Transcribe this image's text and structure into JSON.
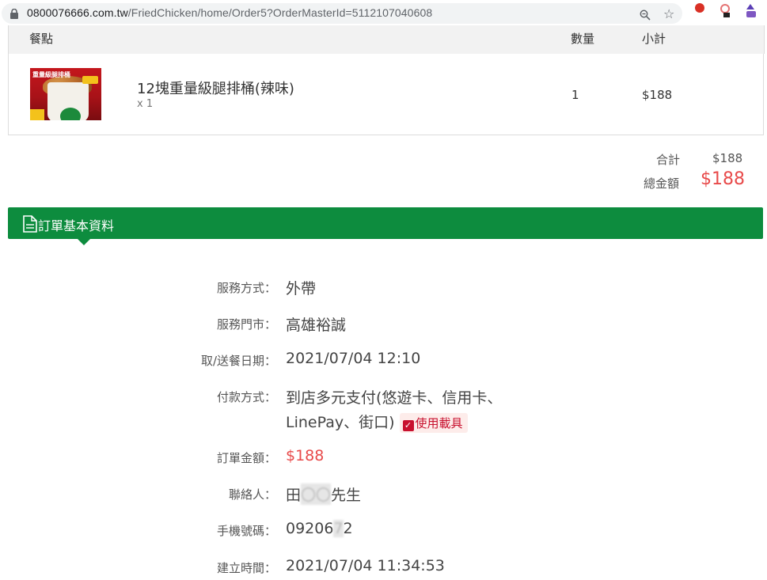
{
  "browser": {
    "url_host": "0800076666.com.tw",
    "url_path": "/FriedChicken/home/Order5?OrderMasterId=5112107040608"
  },
  "table": {
    "headers": {
      "item": "餐點",
      "qty": "數量",
      "subtotal": "小計"
    },
    "rows": [
      {
        "image_text": "重量級腿排桶",
        "name": "12塊重量級腿排桶(辣味)",
        "qty_note": "x 1",
        "qty": "1",
        "subtotal": "$188"
      }
    ]
  },
  "summary": {
    "subtotal_label": "合計",
    "subtotal_value": "$188",
    "total_label": "總金額",
    "total_value": "$188"
  },
  "section": {
    "title": "訂單基本資料"
  },
  "order_info": {
    "service_label": "服務方式：",
    "service_value": "外帶",
    "store_label": "服務門市：",
    "store_value": "高雄裕誠",
    "date_label": "取/送餐日期：",
    "date_value": "2021/07/04 12:10",
    "payment_label": "付款方式：",
    "payment_line1": "到店多元支付(悠遊卡、信用卡、",
    "payment_line2": "LinePay、街口)",
    "payment_badge": "使用載具",
    "amount_label": "訂單金額：",
    "amount_value": "$188",
    "contact_label": "聯絡人：",
    "contact_value_start": "田",
    "contact_value_hidden": "〇〇",
    "contact_value_end": "先生",
    "phone_label": "手機號碼：",
    "phone_value_start": "09206",
    "phone_value_hidden": "7",
    "phone_value_end": "2",
    "created_label": "建立時間：",
    "created_value": "2021/07/04 11:34:53"
  },
  "colors": {
    "green": "#0d8c3e",
    "price_red": "#e84a4a",
    "badge_red": "#c8102e"
  },
  "icons": [
    "lock-icon",
    "zoom-icon",
    "star-icon",
    "extension-icon",
    "document-icon",
    "checkbox-icon"
  ]
}
